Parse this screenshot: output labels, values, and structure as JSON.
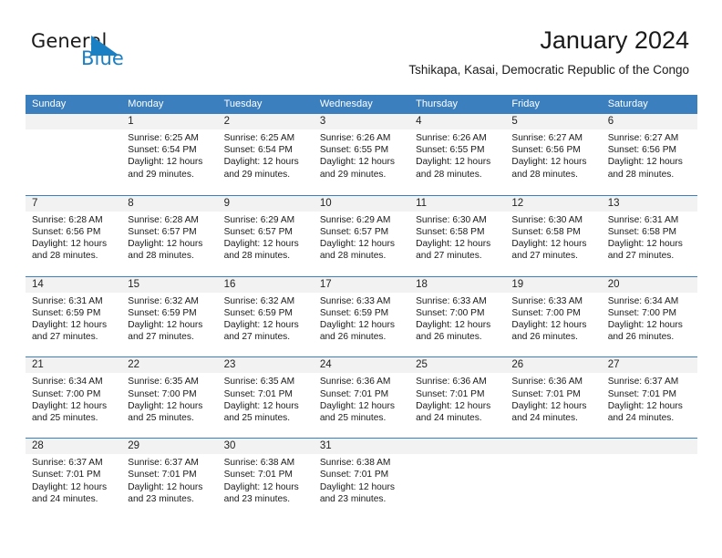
{
  "brand": {
    "name_part1": "General",
    "name_part2": "Blue",
    "logo_icon": "triangle-logo-icon",
    "accent_color": "#1b7fc4"
  },
  "header": {
    "title": "January 2024",
    "subtitle": "Tshikapa, Kasai, Democratic Republic of the Congo"
  },
  "colors": {
    "header_blue": "#3c7fbf",
    "daynum_band": "#f2f2f2",
    "text": "#1a1a1a"
  },
  "calendar": {
    "weekdays": [
      "Sunday",
      "Monday",
      "Tuesday",
      "Wednesday",
      "Thursday",
      "Friday",
      "Saturday"
    ],
    "labels": {
      "sunrise": "Sunrise:",
      "sunset": "Sunset:",
      "daylight": "Daylight:"
    },
    "weeks": [
      [
        {
          "day": "",
          "sunrise": "",
          "sunset": "",
          "daylight_a": "",
          "daylight_b": ""
        },
        {
          "day": "1",
          "sunrise": "Sunrise: 6:25 AM",
          "sunset": "Sunset: 6:54 PM",
          "daylight_a": "Daylight: 12 hours",
          "daylight_b": "and 29 minutes."
        },
        {
          "day": "2",
          "sunrise": "Sunrise: 6:25 AM",
          "sunset": "Sunset: 6:54 PM",
          "daylight_a": "Daylight: 12 hours",
          "daylight_b": "and 29 minutes."
        },
        {
          "day": "3",
          "sunrise": "Sunrise: 6:26 AM",
          "sunset": "Sunset: 6:55 PM",
          "daylight_a": "Daylight: 12 hours",
          "daylight_b": "and 29 minutes."
        },
        {
          "day": "4",
          "sunrise": "Sunrise: 6:26 AM",
          "sunset": "Sunset: 6:55 PM",
          "daylight_a": "Daylight: 12 hours",
          "daylight_b": "and 28 minutes."
        },
        {
          "day": "5",
          "sunrise": "Sunrise: 6:27 AM",
          "sunset": "Sunset: 6:56 PM",
          "daylight_a": "Daylight: 12 hours",
          "daylight_b": "and 28 minutes."
        },
        {
          "day": "6",
          "sunrise": "Sunrise: 6:27 AM",
          "sunset": "Sunset: 6:56 PM",
          "daylight_a": "Daylight: 12 hours",
          "daylight_b": "and 28 minutes."
        }
      ],
      [
        {
          "day": "7",
          "sunrise": "Sunrise: 6:28 AM",
          "sunset": "Sunset: 6:56 PM",
          "daylight_a": "Daylight: 12 hours",
          "daylight_b": "and 28 minutes."
        },
        {
          "day": "8",
          "sunrise": "Sunrise: 6:28 AM",
          "sunset": "Sunset: 6:57 PM",
          "daylight_a": "Daylight: 12 hours",
          "daylight_b": "and 28 minutes."
        },
        {
          "day": "9",
          "sunrise": "Sunrise: 6:29 AM",
          "sunset": "Sunset: 6:57 PM",
          "daylight_a": "Daylight: 12 hours",
          "daylight_b": "and 28 minutes."
        },
        {
          "day": "10",
          "sunrise": "Sunrise: 6:29 AM",
          "sunset": "Sunset: 6:57 PM",
          "daylight_a": "Daylight: 12 hours",
          "daylight_b": "and 28 minutes."
        },
        {
          "day": "11",
          "sunrise": "Sunrise: 6:30 AM",
          "sunset": "Sunset: 6:58 PM",
          "daylight_a": "Daylight: 12 hours",
          "daylight_b": "and 27 minutes."
        },
        {
          "day": "12",
          "sunrise": "Sunrise: 6:30 AM",
          "sunset": "Sunset: 6:58 PM",
          "daylight_a": "Daylight: 12 hours",
          "daylight_b": "and 27 minutes."
        },
        {
          "day": "13",
          "sunrise": "Sunrise: 6:31 AM",
          "sunset": "Sunset: 6:58 PM",
          "daylight_a": "Daylight: 12 hours",
          "daylight_b": "and 27 minutes."
        }
      ],
      [
        {
          "day": "14",
          "sunrise": "Sunrise: 6:31 AM",
          "sunset": "Sunset: 6:59 PM",
          "daylight_a": "Daylight: 12 hours",
          "daylight_b": "and 27 minutes."
        },
        {
          "day": "15",
          "sunrise": "Sunrise: 6:32 AM",
          "sunset": "Sunset: 6:59 PM",
          "daylight_a": "Daylight: 12 hours",
          "daylight_b": "and 27 minutes."
        },
        {
          "day": "16",
          "sunrise": "Sunrise: 6:32 AM",
          "sunset": "Sunset: 6:59 PM",
          "daylight_a": "Daylight: 12 hours",
          "daylight_b": "and 27 minutes."
        },
        {
          "day": "17",
          "sunrise": "Sunrise: 6:33 AM",
          "sunset": "Sunset: 6:59 PM",
          "daylight_a": "Daylight: 12 hours",
          "daylight_b": "and 26 minutes."
        },
        {
          "day": "18",
          "sunrise": "Sunrise: 6:33 AM",
          "sunset": "Sunset: 7:00 PM",
          "daylight_a": "Daylight: 12 hours",
          "daylight_b": "and 26 minutes."
        },
        {
          "day": "19",
          "sunrise": "Sunrise: 6:33 AM",
          "sunset": "Sunset: 7:00 PM",
          "daylight_a": "Daylight: 12 hours",
          "daylight_b": "and 26 minutes."
        },
        {
          "day": "20",
          "sunrise": "Sunrise: 6:34 AM",
          "sunset": "Sunset: 7:00 PM",
          "daylight_a": "Daylight: 12 hours",
          "daylight_b": "and 26 minutes."
        }
      ],
      [
        {
          "day": "21",
          "sunrise": "Sunrise: 6:34 AM",
          "sunset": "Sunset: 7:00 PM",
          "daylight_a": "Daylight: 12 hours",
          "daylight_b": "and 25 minutes."
        },
        {
          "day": "22",
          "sunrise": "Sunrise: 6:35 AM",
          "sunset": "Sunset: 7:00 PM",
          "daylight_a": "Daylight: 12 hours",
          "daylight_b": "and 25 minutes."
        },
        {
          "day": "23",
          "sunrise": "Sunrise: 6:35 AM",
          "sunset": "Sunset: 7:01 PM",
          "daylight_a": "Daylight: 12 hours",
          "daylight_b": "and 25 minutes."
        },
        {
          "day": "24",
          "sunrise": "Sunrise: 6:36 AM",
          "sunset": "Sunset: 7:01 PM",
          "daylight_a": "Daylight: 12 hours",
          "daylight_b": "and 25 minutes."
        },
        {
          "day": "25",
          "sunrise": "Sunrise: 6:36 AM",
          "sunset": "Sunset: 7:01 PM",
          "daylight_a": "Daylight: 12 hours",
          "daylight_b": "and 24 minutes."
        },
        {
          "day": "26",
          "sunrise": "Sunrise: 6:36 AM",
          "sunset": "Sunset: 7:01 PM",
          "daylight_a": "Daylight: 12 hours",
          "daylight_b": "and 24 minutes."
        },
        {
          "day": "27",
          "sunrise": "Sunrise: 6:37 AM",
          "sunset": "Sunset: 7:01 PM",
          "daylight_a": "Daylight: 12 hours",
          "daylight_b": "and 24 minutes."
        }
      ],
      [
        {
          "day": "28",
          "sunrise": "Sunrise: 6:37 AM",
          "sunset": "Sunset: 7:01 PM",
          "daylight_a": "Daylight: 12 hours",
          "daylight_b": "and 24 minutes."
        },
        {
          "day": "29",
          "sunrise": "Sunrise: 6:37 AM",
          "sunset": "Sunset: 7:01 PM",
          "daylight_a": "Daylight: 12 hours",
          "daylight_b": "and 23 minutes."
        },
        {
          "day": "30",
          "sunrise": "Sunrise: 6:38 AM",
          "sunset": "Sunset: 7:01 PM",
          "daylight_a": "Daylight: 12 hours",
          "daylight_b": "and 23 minutes."
        },
        {
          "day": "31",
          "sunrise": "Sunrise: 6:38 AM",
          "sunset": "Sunset: 7:01 PM",
          "daylight_a": "Daylight: 12 hours",
          "daylight_b": "and 23 minutes."
        },
        {
          "day": "",
          "sunrise": "",
          "sunset": "",
          "daylight_a": "",
          "daylight_b": ""
        },
        {
          "day": "",
          "sunrise": "",
          "sunset": "",
          "daylight_a": "",
          "daylight_b": ""
        },
        {
          "day": "",
          "sunrise": "",
          "sunset": "",
          "daylight_a": "",
          "daylight_b": ""
        }
      ]
    ]
  }
}
